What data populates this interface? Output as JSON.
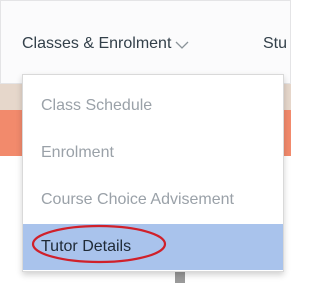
{
  "navbar": {
    "menu_label": "Classes & Enrolment",
    "next_label": "Stu"
  },
  "dropdown": {
    "items": [
      {
        "label": "Class Schedule"
      },
      {
        "label": "Enrolment"
      },
      {
        "label": "Course Choice Advisement"
      },
      {
        "label": "Tutor Details"
      }
    ],
    "active_index": 3
  },
  "colors": {
    "active_bg": "#a9c3ec",
    "highlight_ring": "#d0202a",
    "salmon_band": "#f28a6c",
    "beige_band": "#e6d7cb"
  }
}
